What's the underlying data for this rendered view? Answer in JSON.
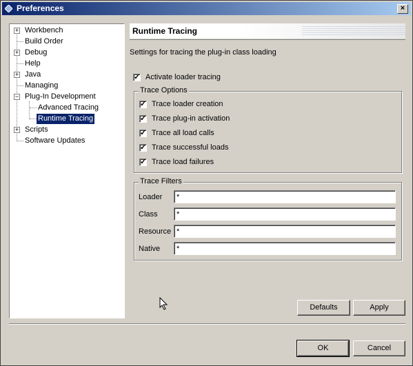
{
  "window": {
    "title": "Preferences",
    "close_label": "×"
  },
  "tree": {
    "items": [
      {
        "label": "Workbench",
        "expander": "+"
      },
      {
        "label": "Build Order",
        "expander": ""
      },
      {
        "label": "Debug",
        "expander": "+"
      },
      {
        "label": "Help",
        "expander": ""
      },
      {
        "label": "Java",
        "expander": "+"
      },
      {
        "label": "Managing",
        "expander": ""
      },
      {
        "label": "Plug-In Development",
        "expander": "−"
      },
      {
        "label": "Advanced Tracing",
        "expander": ""
      },
      {
        "label": "Runtime Tracing",
        "expander": "",
        "selected": true
      },
      {
        "label": "Scripts",
        "expander": "+"
      },
      {
        "label": "Software Updates",
        "expander": ""
      }
    ]
  },
  "page": {
    "title": "Runtime Tracing",
    "description": "Settings for tracing the plug-in class loading",
    "activate_label": "Activate loader tracing",
    "activate_checked": true
  },
  "trace_options": {
    "title": "Trace Options",
    "items": [
      {
        "label": "Trace loader creation",
        "checked": true
      },
      {
        "label": "Trace plug-in activation",
        "checked": true
      },
      {
        "label": "Trace all load calls",
        "checked": true
      },
      {
        "label": "Trace successful loads",
        "checked": true
      },
      {
        "label": "Trace load failures",
        "checked": true
      }
    ]
  },
  "trace_filters": {
    "title": "Trace Filters",
    "fields": [
      {
        "label": "Loader",
        "value": "*"
      },
      {
        "label": "Class",
        "value": "*"
      },
      {
        "label": "Resource",
        "value": "*"
      },
      {
        "label": "Native",
        "value": "*"
      }
    ]
  },
  "buttons": {
    "defaults": "Defaults",
    "apply": "Apply",
    "ok": "OK",
    "cancel": "Cancel"
  },
  "colors": {
    "title_bar": "#0a246a",
    "selection": "#0a246a",
    "face": "#d4d0c8"
  }
}
